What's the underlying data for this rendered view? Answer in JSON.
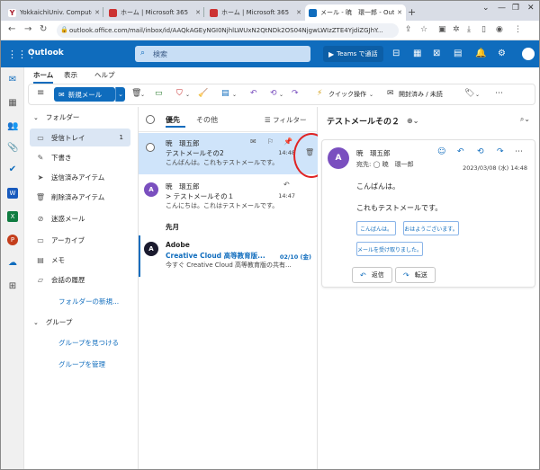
{
  "browser": {
    "tabs": [
      {
        "title": "YokkaichiUniv. Compute",
        "active": false
      },
      {
        "title": "ホーム | Microsoft 365",
        "active": false
      },
      {
        "title": "ホーム | Microsoft 365",
        "active": false
      },
      {
        "title": "メール - 暁　環一郎 - Out",
        "active": true
      }
    ],
    "new_tab": "+",
    "url": "outlook.office.com/mail/inbox/id/AAQkAGEyNGI0NjhlLWUxN2QtNDk2OS04NjgwLWIzZTE4YjdiZGJhY..."
  },
  "app": {
    "name": "Outlook",
    "search_placeholder": "検索",
    "teams_button": "Teams で通話"
  },
  "ribbon": {
    "tabs": [
      "ホーム",
      "表示",
      "ヘルプ"
    ],
    "new_mail": "新規メール",
    "quick_steps": "クイック操作",
    "read_unread": "開封済み / 未読"
  },
  "folders": {
    "header": "フォルダー",
    "items": [
      {
        "label": "受信トレイ",
        "count": "1",
        "icon": "inbox-icon"
      },
      {
        "label": "下書き",
        "icon": "pencil-icon"
      },
      {
        "label": "送信済みアイテム",
        "icon": "send-icon"
      },
      {
        "label": "削除済みアイテム",
        "icon": "trash-icon"
      },
      {
        "label": "迷惑メール",
        "icon": "junk-icon"
      },
      {
        "label": "アーカイブ",
        "icon": "archive-icon"
      },
      {
        "label": "メモ",
        "icon": "note-icon"
      },
      {
        "label": "会話の履歴",
        "icon": "folder-icon"
      }
    ],
    "new_folder": "フォルダーの新規...",
    "groups_header": "グループ",
    "find_groups": "グループを見つける",
    "manage_groups": "グループを管理"
  },
  "message_list": {
    "tab_focused": "優先",
    "tab_other": "その他",
    "filter": "フィルター",
    "section_last_month": "先月",
    "messages": [
      {
        "sender": "暁　環五郎",
        "subject": "テストメールその2",
        "preview": "こんばんは。これもテストメールです。",
        "time": "14:48"
      },
      {
        "sender": "暁　環五郎",
        "subject": "> テストメールその１",
        "preview": "こんにちは。これはテストメールです。",
        "time": "14:47",
        "avatar": "A"
      },
      {
        "sender": "Adobe",
        "subject": "Creative Cloud 高等教育版...",
        "preview": "今すぐ Creative Cloud 高等教育版の共有...",
        "time": "02/10 (金)",
        "avatar": "A"
      }
    ]
  },
  "reading": {
    "title": "テストメールその２",
    "from": "暁　環五郎",
    "to": "宛先:  ◯ 暁　環一郎",
    "date": "2023/03/08 (水) 14:48",
    "body_line1": "こんばんは。",
    "body_line2": "これもテストメールです。",
    "suggested_replies": [
      "こんばんは。",
      "おはようございます。",
      "メールを受け取りました。"
    ],
    "reply": "返信",
    "forward": "転送",
    "avatar": "A"
  },
  "colors": {
    "brand": "#0f6cbd",
    "selected_row": "#cfe4fa",
    "highlight_circle": "#e02424"
  }
}
